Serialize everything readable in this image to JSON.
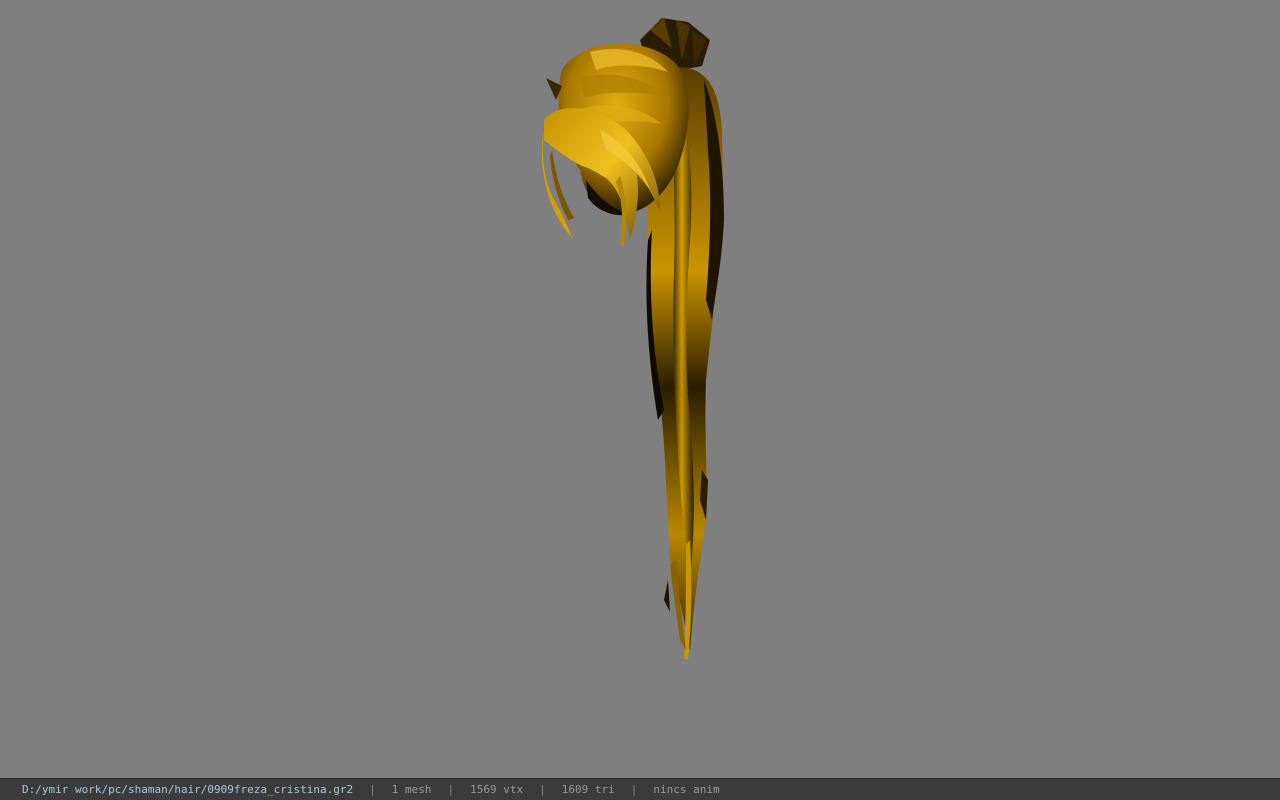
{
  "statusbar": {
    "file_path": "D:/ymir work/pc/shaman/hair/0909freza_cristina.gr2",
    "mesh_count": "1 mesh",
    "vertex_count": "1569 vtx",
    "triangle_count": "1609 tri",
    "animation": "nincs anim",
    "separator": "|"
  },
  "colors": {
    "viewport_background": "#7f7f7f",
    "hair_highlight": "#d9a400",
    "hair_shadow": "#1a1200",
    "statusbar_background": "#3b3b3b",
    "path_text": "#a8c8dc"
  }
}
